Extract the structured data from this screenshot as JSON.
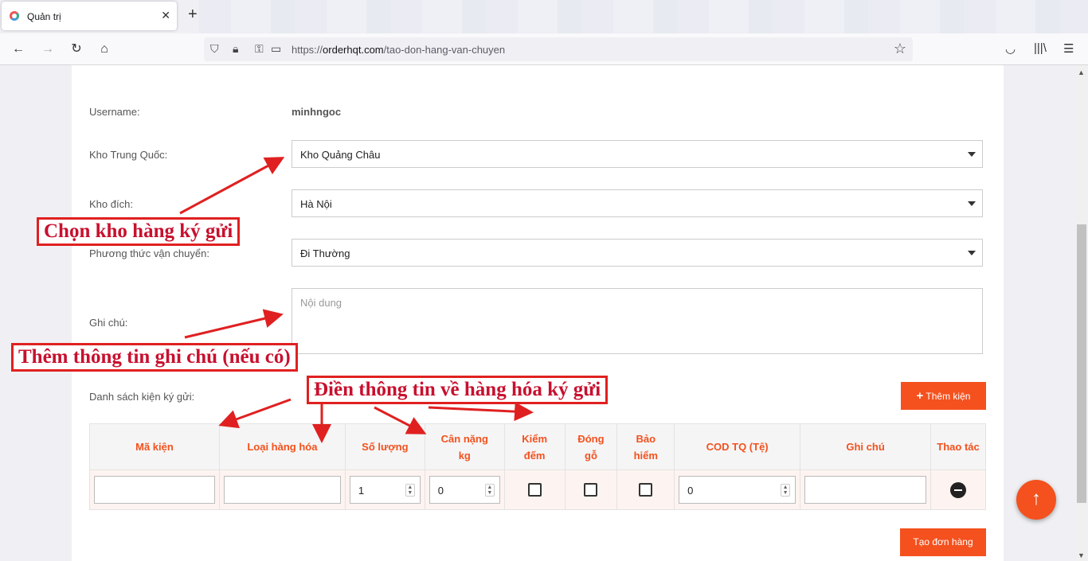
{
  "browser": {
    "tab_title": "Quản trị",
    "url_host": "orderhqt.com",
    "url_scheme": "https://",
    "url_path": "/tao-don-hang-van-chuyen"
  },
  "form": {
    "username_label": "Username:",
    "username_value": "minhngoc",
    "kho_tq_label": "Kho Trung Quốc:",
    "kho_tq_value": "Kho Quảng Châu",
    "kho_dich_label": "Kho đích:",
    "kho_dich_value": "Hà Nội",
    "phuong_thuc_label": "Phương thức vận chuyển:",
    "phuong_thuc_value": "Đi Thường",
    "ghi_chu_label": "Ghi chú:",
    "ghi_chu_placeholder": "Nội dung",
    "danh_sach_label": "Danh sách kiện ký gửi:",
    "them_kien_button": "Thêm kiện",
    "tao_don_button": "Tạo đơn hàng"
  },
  "table": {
    "headers": [
      "Mã kiện",
      "Loại hàng hóa",
      "Số lượng",
      "Cân nặng kg",
      "Kiểm đếm",
      "Đóng gỗ",
      "Bảo hiểm",
      "COD TQ (Tệ)",
      "Ghi chú",
      "Thao tác"
    ],
    "row": {
      "ma_kien": "",
      "loai_hang": "",
      "so_luong": "1",
      "can_nang": "0",
      "kiem_dem": false,
      "dong_go": false,
      "bao_hiem": false,
      "cod_tq": "0",
      "ghi_chu": ""
    }
  },
  "annotations": {
    "chon_kho": "Chọn kho hàng ký gửi",
    "them_ghi_chu": "Thêm thông tin ghi chú (nếu có)",
    "dien_thong_tin": "Điền thông tin về hàng hóa ký gửi"
  },
  "colors": {
    "accent": "#f4511e",
    "annotation_red": "#e02020"
  },
  "icons": {
    "back": "arrow-left-icon",
    "forward": "arrow-right-icon",
    "reload": "reload-icon",
    "home": "home-icon",
    "shield": "shield-icon",
    "lock": "lock-icon",
    "bookmark": "star-icon",
    "pocket": "pocket-icon",
    "library": "library-icon",
    "menu": "hamburger-icon",
    "scroll_top": "arrow-up-icon",
    "remove_row": "minus-circle-icon"
  }
}
